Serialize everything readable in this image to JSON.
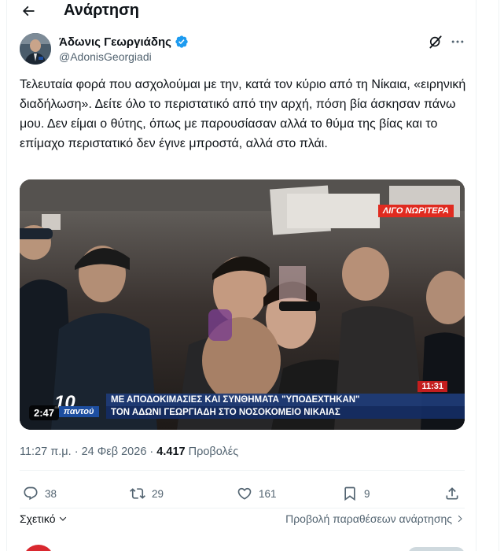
{
  "header": {
    "title": "Ανάρτηση",
    "back_icon": "arrow-left-icon"
  },
  "author": {
    "name": "Άδωνις Γεωργιάδης",
    "handle": "@AdonisGeorgiadi",
    "verified": true,
    "verified_color": "#1d9bf0"
  },
  "tweet": {
    "text": "Τελευταία φορά που ασχολούμαι με την, κατά τον κύριο από τη Νίκαια, «ειρηνική διαδήλωση». Δείτε όλο το περιστατικό από την αρχή, πόση βία άσκησαν πάνω μου. Δεν είμαι ο θύτης, όπως με παρουσίασαν αλλά το θύμα της βίας και το επίμαχο περιστατικό δεν έγινε μπροστά, αλλά στο πλάι."
  },
  "video": {
    "duration": "2:47",
    "badge": "ΛΙΓΟ ΝΩΡΙΤΕΡΑ",
    "news_time": "11:31",
    "headline_line1": "ΜΕ ΑΠΟΔΟΚΙΜΑΣΙΕΣ ΚΑΙ ΣΥΝΘΗΜΑΤΑ \"ΥΠΟΔΕΧΤΗΚΑΝ\"",
    "headline_line2": "ΤΟΝ ΑΔΩΝΙ ΓΕΩΡΓΙΑΔΗ ΣΤΟ ΝΟΣΟΚΟΜΕΙΟ ΝΙΚΑΙΑΣ",
    "channel_number": "10",
    "channel_name": "παντού"
  },
  "meta": {
    "time": "11:27 π.μ.",
    "separator": "·",
    "date": "24 Φεβ 2026",
    "views_count": "4.417",
    "views_label": "Προβολές"
  },
  "actions": {
    "replies": "38",
    "reposts": "29",
    "likes": "161",
    "bookmarks": "9"
  },
  "footer": {
    "relevant_label": "Σχετικό",
    "quotes_label": "Προβολή παραθέσεων ανάρτησης"
  },
  "colors": {
    "text_primary": "#0f1419",
    "text_secondary": "#536471",
    "accent": "#1d9bf0",
    "divider": "#eff3f4"
  }
}
